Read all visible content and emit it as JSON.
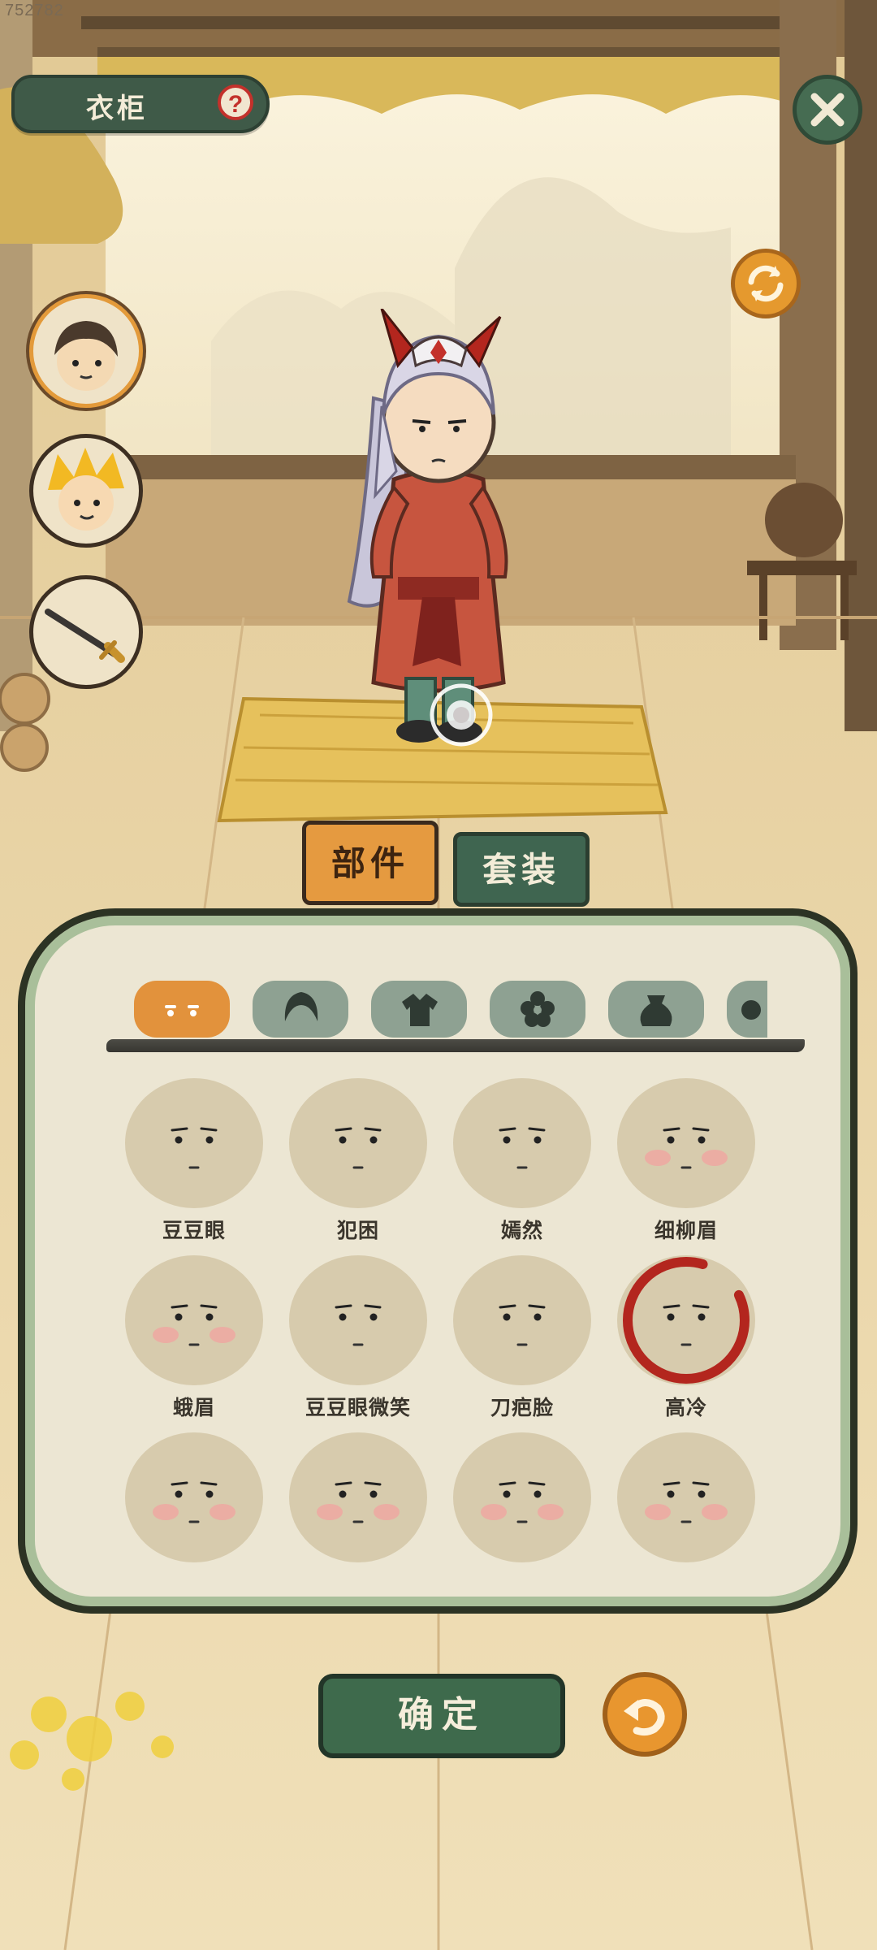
{
  "watermark": "752782",
  "header": {
    "title": "衣柜",
    "help_glyph": "?"
  },
  "icons": {
    "close": "close-icon",
    "refresh": "refresh-icon",
    "help": "question-icon",
    "back": "undo-icon"
  },
  "side_slots": [
    {
      "name": "hero-portrait",
      "active": true
    },
    {
      "name": "monkey-king-portrait",
      "active": false
    },
    {
      "name": "sword-weapon",
      "active": false
    }
  ],
  "tabs": [
    {
      "label": "部件",
      "active": true
    },
    {
      "label": "套装",
      "active": false
    }
  ],
  "categories": [
    "face-eyes-icon",
    "hair-icon",
    "clothes-icon",
    "flower-accessory-icon",
    "pouch-icon",
    "more-icon"
  ],
  "faces": [
    {
      "label": "豆豆眼",
      "blush": false,
      "selected": false
    },
    {
      "label": "犯困",
      "blush": false,
      "selected": false
    },
    {
      "label": "嫣然",
      "blush": false,
      "selected": false
    },
    {
      "label": "细柳眉",
      "blush": true,
      "selected": false
    },
    {
      "label": "蛾眉",
      "blush": true,
      "selected": false
    },
    {
      "label": "豆豆眼微笑",
      "blush": false,
      "selected": false
    },
    {
      "label": "刀疤脸",
      "blush": false,
      "selected": false
    },
    {
      "label": "高冷",
      "blush": false,
      "selected": true
    },
    {
      "label": "",
      "blush": true,
      "selected": false
    },
    {
      "label": "",
      "blush": true,
      "selected": false
    },
    {
      "label": "",
      "blush": true,
      "selected": false
    },
    {
      "label": "",
      "blush": true,
      "selected": false
    }
  ],
  "footer": {
    "confirm_label": "确定"
  },
  "colors": {
    "accent": "#e59a40",
    "primary_green": "#3e6a4c",
    "selection_red": "#b3261e"
  }
}
